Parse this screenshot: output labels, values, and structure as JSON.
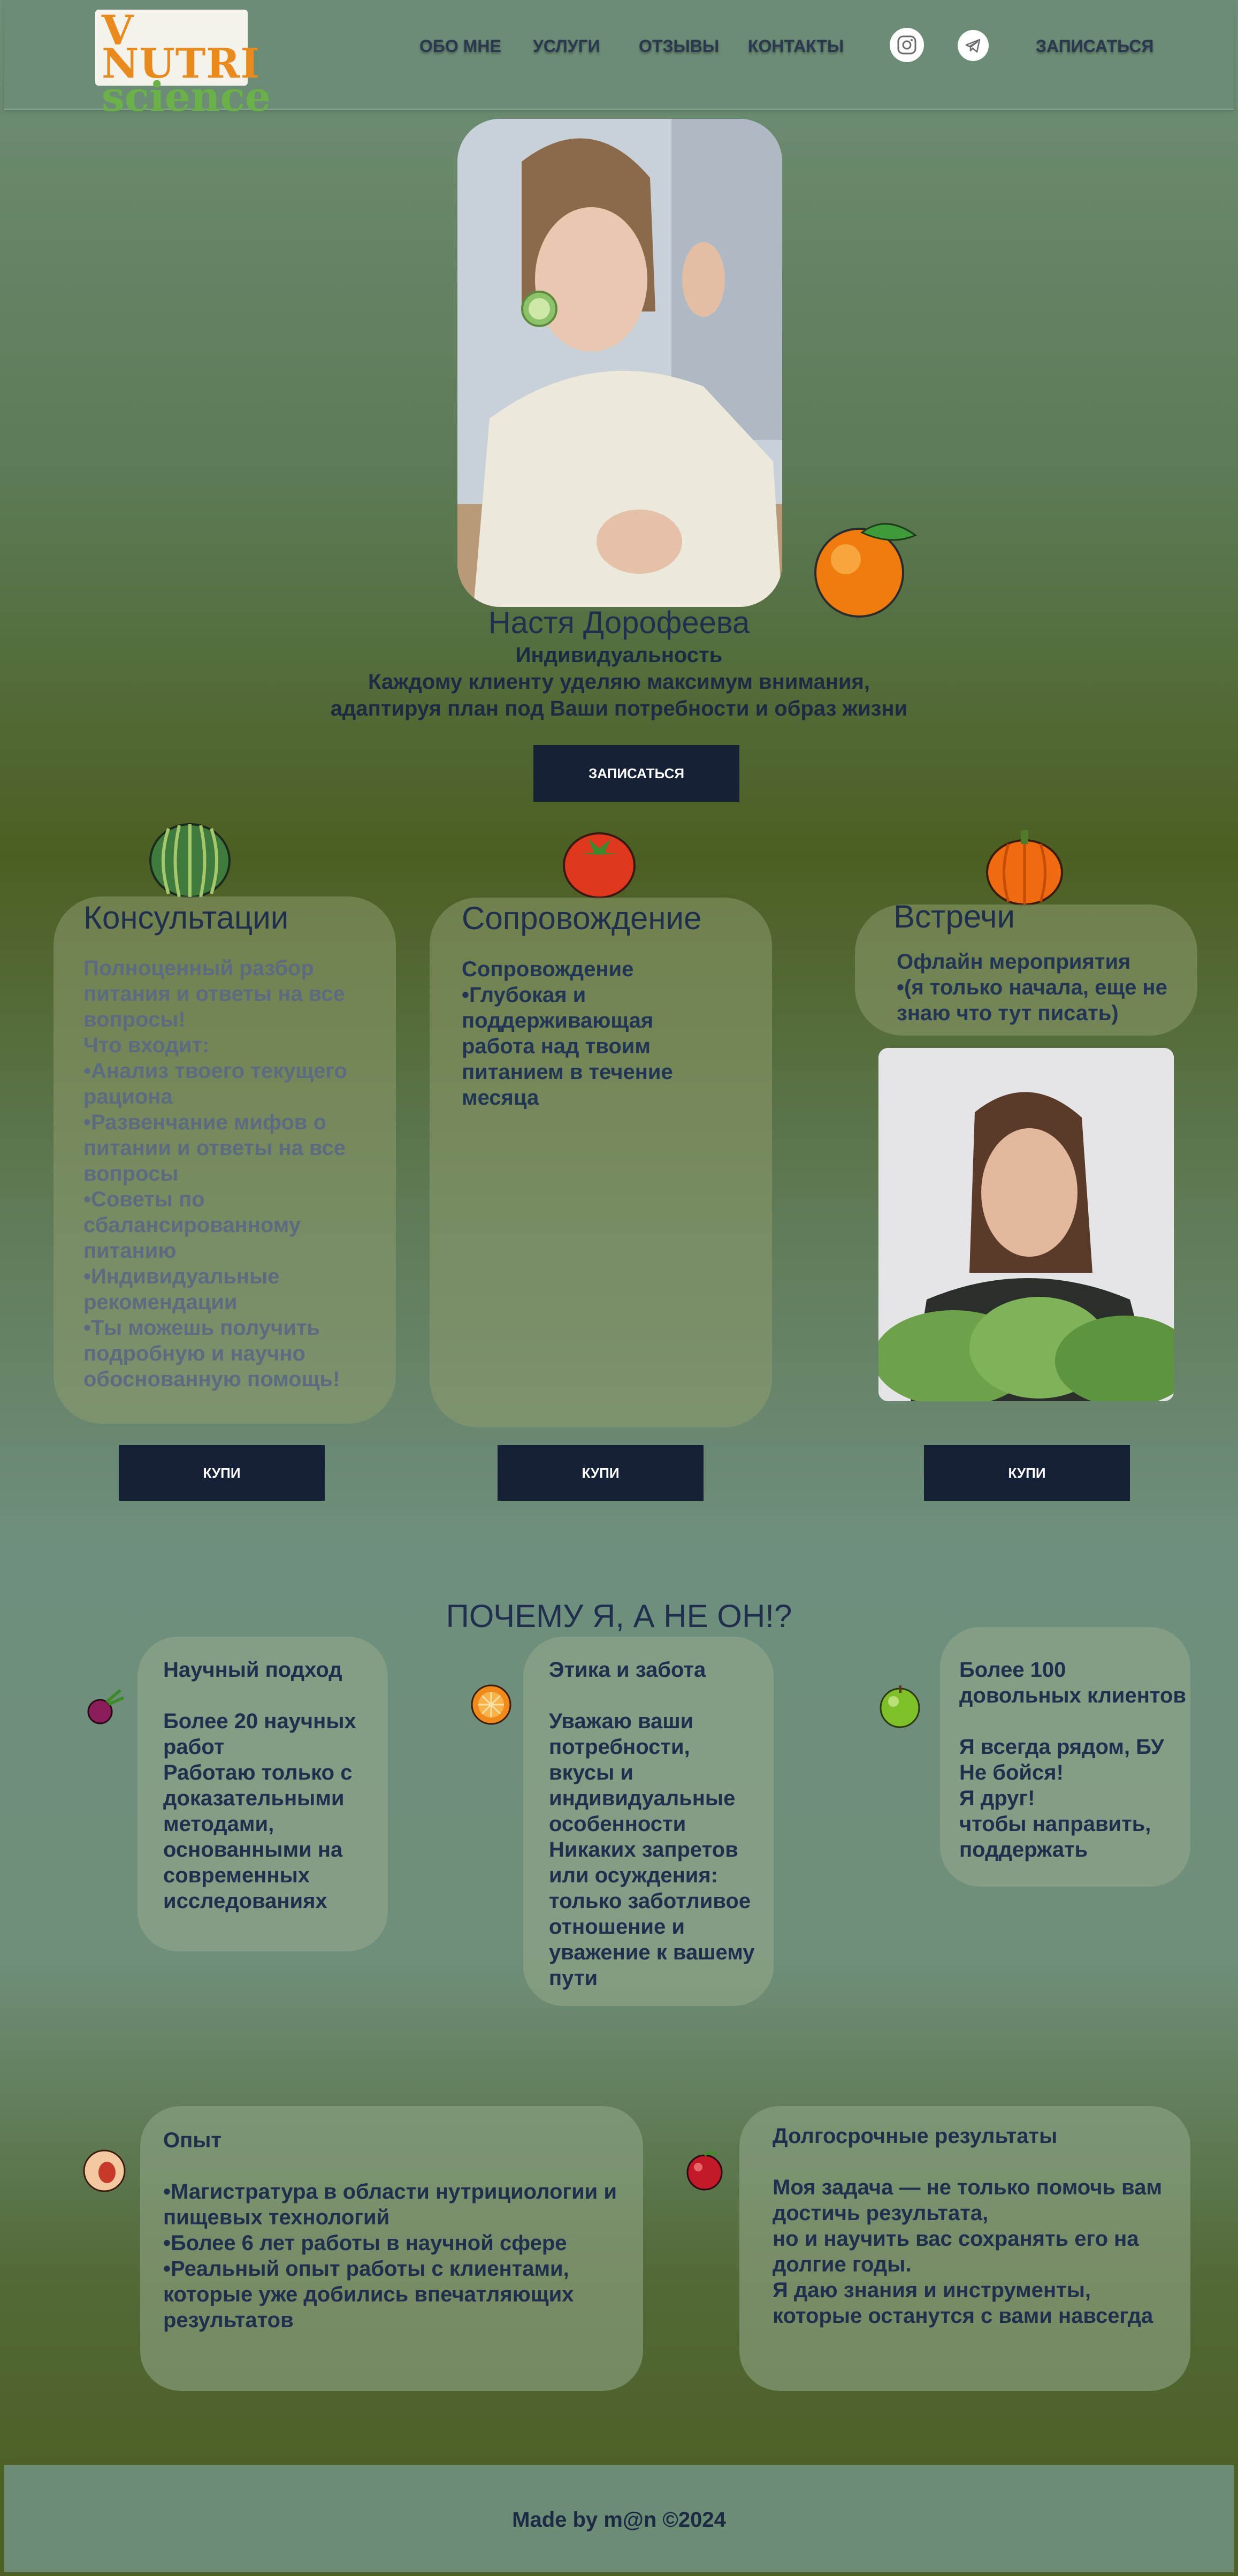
{
  "header": {
    "logo_line1": "V NUTRI",
    "logo_line2": "science",
    "nav": [
      "ОБО МНЕ",
      "УСЛУГИ",
      "ОТЗЫВЫ",
      "КОНТАКТЫ"
    ],
    "icons": [
      "instagram-icon",
      "telegram-icon"
    ],
    "cta": "ЗАПИСАТЬСЯ"
  },
  "hero": {
    "name": "Настя Дорофеева",
    "subtitle": "Индивидуальность",
    "line1": "Каждому клиенту уделяю максимум внимания,",
    "line2": "адаптируя план под Ваши потребности и образ жизни",
    "button": "ЗАПИСАТЬСЯ"
  },
  "services": [
    {
      "title": "Консультации",
      "body_intro": "Полноценный разбор питания и ответы на все вопросы!",
      "body": "Что входит:\n•Анализ твоего текущего рациона\n•Развенчание мифов о питании и ответы на все вопросы\n•Советы по сбалансированному питанию\n•Индивидуальные рекомендации\n•Ты можешь получить подробную и научно обоснованную помощь!",
      "button": "КУПИ"
    },
    {
      "title": "Сопровождение",
      "body": "Сопровождение\n•Глубокая и поддерживающая работа над твоим питанием в течение месяца",
      "button": "КУПИ"
    },
    {
      "title": "Встречи",
      "body": "Офлайн мероприятия\n•(я только начала, еще не знаю что тут писать)",
      "button": "КУПИ"
    }
  ],
  "why": {
    "title": "ПОЧЕМУ Я, А НЕ ОН!?",
    "cards": [
      {
        "heading": "Научный подход",
        "text": "Более 20 научных работ\nРаботаю только с доказательными методами, основанными на современных исследованиях"
      },
      {
        "heading": "Этика и забота",
        "text": "Уважаю ваши потребности, вкусы и индивидуальные особенности\nНикаких запретов или осуждения: только заботливое отношение и уважение к вашему пути"
      },
      {
        "heading": "Более 100 довольных клиентов",
        "text": "Я всегда рядом, БУ\nНе бойся!\nЯ друг!\nчтобы направить, поддержать"
      },
      {
        "heading": "Опыт",
        "text": "•Магистратура в области нутрициологии и пищевых технологий\n•Более 6 лет работы в научной сфере\n•Реальный опыт работы с клиентами, которые уже добились впечатляющих результатов"
      },
      {
        "heading": "Долгосрочные результаты",
        "text": "Моя задача — не только помочь вам достичь результата,\nно и научить вас сохранять его на долгие годы.\nЯ даю знания и инструменты, которые останутся с вами навсегда"
      }
    ]
  },
  "footer": {
    "text": "Made by m@n ©2024"
  }
}
